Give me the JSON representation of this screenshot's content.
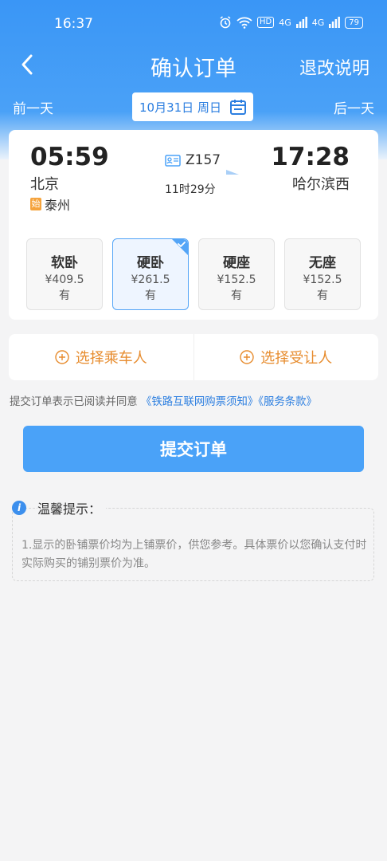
{
  "status_bar": {
    "time": "16:37",
    "hd": "HD",
    "signal1": "4G",
    "signal2": "4G",
    "battery": "79"
  },
  "nav": {
    "title": "确认订单",
    "right_label": "退改说明"
  },
  "date_bar": {
    "prev": "前一天",
    "date": "10月31日 周日",
    "next": "后一天"
  },
  "train": {
    "departure_time": "05:59",
    "departure_station": "北京",
    "arrival_time": "17:28",
    "arrival_station": "哈尔滨西",
    "train_no": "Z157",
    "duration": "11时29分",
    "origin_badge": "始",
    "origin_station": "泰州"
  },
  "seats": [
    {
      "name": "软卧",
      "price": "¥409.5",
      "availability": "有",
      "selected": false
    },
    {
      "name": "硬卧",
      "price": "¥261.5",
      "availability": "有",
      "selected": true
    },
    {
      "name": "硬座",
      "price": "¥152.5",
      "availability": "有",
      "selected": false
    },
    {
      "name": "无座",
      "price": "¥152.5",
      "availability": "有",
      "selected": false
    }
  ],
  "actions": {
    "choose_passenger": "选择乘车人",
    "choose_beneficiary": "选择受让人"
  },
  "agreement": {
    "prefix": "提交订单表示已阅读并同意 ",
    "link1": "《铁路互联网购票须知》",
    "link2": "《服务条款》"
  },
  "submit": {
    "label": "提交订单"
  },
  "tips": {
    "title": "温馨提示：",
    "text": "1.显示的卧铺票价均为上铺票价，供您参考。具体票价以您确认支付时实际购买的铺别票价为准。"
  },
  "colors": {
    "primary": "#4aa2f8",
    "accent_orange": "#e78c2e",
    "link": "#2b7ee0"
  }
}
